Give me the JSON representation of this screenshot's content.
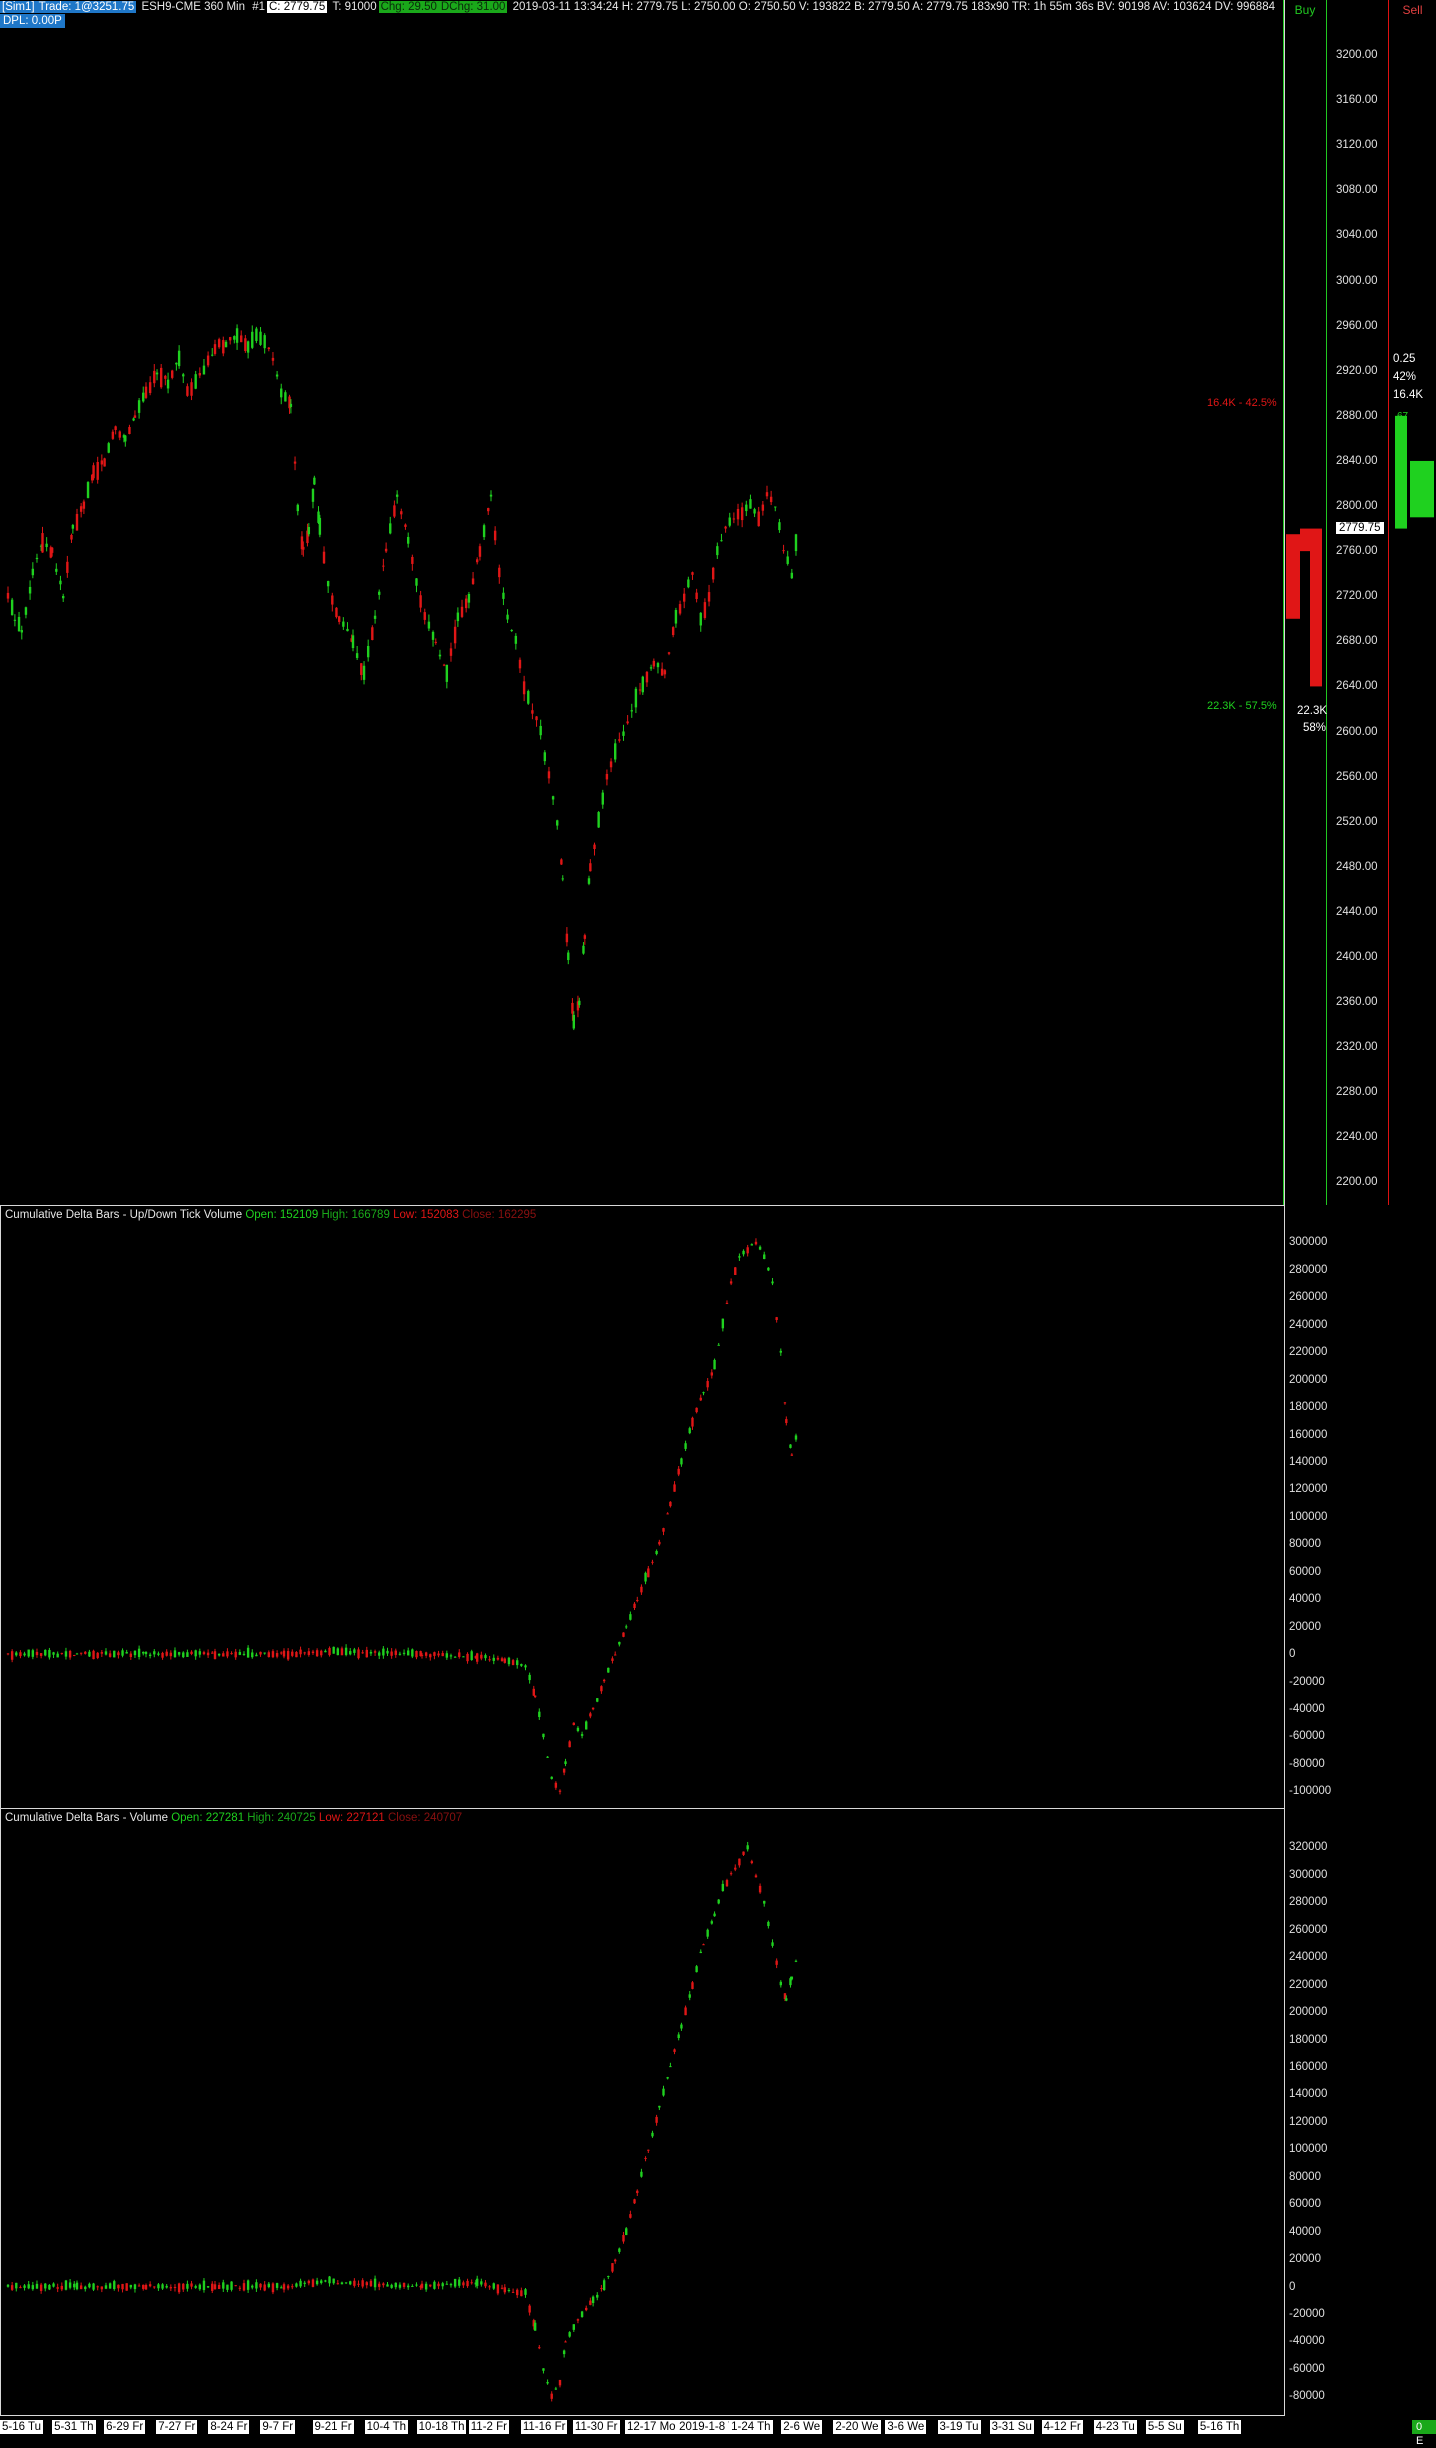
{
  "header": {
    "sim": "[Sim1]",
    "trade": "Trade: 1@3251.75",
    "symbol": "ESH9-CME  360 Min",
    "bar_number": "#1",
    "close": "C: 2779.75",
    "ticks": "T: 91000",
    "chg": "Chg: 29.50",
    "dchg": "DChg: 31.00",
    "info": "2019-03-11 13:34:24 H: 2779.75 L: 2750.00 O: 2750.50 V: 193822 B: 2779.50 A: 2779.75 183x90 TR: 1h 55m 36s BV: 90198 AV: 103624 DV: 996884",
    "dpl": "DPL: 0.00P"
  },
  "dom": {
    "buy_label": "Buy",
    "sell_label": "Sell",
    "price_tag": "2779.75",
    "upper_ratio": "16.4K - 42.5%",
    "lower_ratio": "22.3K - 57.5%",
    "lower_total": "22.3K",
    "lower_pct": "58%",
    "right_tick": "0.25",
    "right_pct": "42%",
    "right_total": "16.4K",
    "right_small": "67"
  },
  "colors": {
    "up": "#1fd11f",
    "down": "#e01616",
    "axis": "#d8d8d8"
  },
  "chart_data": [
    {
      "type": "candlestick",
      "title": "ESH9-CME 360 Min",
      "ylim": [
        2180,
        3240
      ],
      "yticks": [
        "3200.00",
        "3160.00",
        "3120.00",
        "3080.00",
        "3040.00",
        "3000.00",
        "2960.00",
        "2920.00",
        "2880.00",
        "2840.00",
        "2800.00",
        "2760.00",
        "2720.00",
        "2680.00",
        "2640.00",
        "2600.00",
        "2560.00",
        "2520.00",
        "2480.00",
        "2440.00",
        "2400.00",
        "2360.00",
        "2320.00",
        "2280.00",
        "2240.00",
        "2200.00"
      ],
      "x": [
        0,
        5,
        10,
        18,
        25,
        32,
        40,
        47,
        55,
        62,
        70,
        78,
        85,
        92,
        100,
        108,
        116,
        124,
        130,
        136,
        142,
        150,
        158,
        166,
        174,
        180,
        186,
        192,
        198,
        205,
        210,
        214,
        218,
        222,
        226,
        232,
        240,
        250,
        258,
        266,
        274,
        282,
        290,
        296,
        302,
        310,
        318,
        326,
        334,
        342,
        350,
        356,
        362,
        368,
        374,
        380,
        386,
        392,
        398,
        402,
        406,
        410,
        414,
        418,
        422,
        428,
        434,
        440,
        446,
        452,
        460,
        468,
        476,
        484,
        490,
        496,
        502,
        508,
        514,
        520,
        526,
        532,
        538,
        544,
        550,
        556,
        562,
        568,
        572
      ],
      "close": [
        2720,
        2700,
        2690,
        2740,
        2770,
        2760,
        2720,
        2780,
        2800,
        2830,
        2840,
        2870,
        2860,
        2880,
        2900,
        2920,
        2910,
        2930,
        2900,
        2910,
        2920,
        2940,
        2945,
        2950,
        2940,
        2950,
        2945,
        2930,
        2900,
        2890,
        2800,
        2760,
        2780,
        2820,
        2780,
        2730,
        2700,
        2680,
        2650,
        2700,
        2760,
        2810,
        2770,
        2730,
        2700,
        2680,
        2650,
        2700,
        2720,
        2760,
        2810,
        2740,
        2700,
        2680,
        2640,
        2620,
        2600,
        2560,
        2520,
        2470,
        2400,
        2340,
        2360,
        2420,
        2480,
        2520,
        2560,
        2580,
        2600,
        2620,
        2640,
        2660,
        2650,
        2700,
        2720,
        2740,
        2700,
        2720,
        2760,
        2780,
        2790,
        2795,
        2800,
        2790,
        2810,
        2800,
        2760,
        2740,
        2775
      ]
    },
    {
      "type": "candlestick",
      "title": "Cumulative Delta Bars - Up/Down Tick Volume",
      "legend": {
        "open": "Open: 152109",
        "high": "High: 166789",
        "low": "Low: 152083",
        "close": "Close: 162295"
      },
      "ylim": [
        -110000,
        320000
      ],
      "yticks": [
        "300000",
        "280000",
        "260000",
        "240000",
        "220000",
        "200000",
        "180000",
        "160000",
        "140000",
        "120000",
        "100000",
        "80000",
        "60000",
        "40000",
        "20000",
        "0",
        "-20000",
        "-40000",
        "-60000",
        "-80000",
        "-100000"
      ],
      "x": [
        0,
        50,
        100,
        150,
        200,
        230,
        260,
        300,
        340,
        360,
        375,
        382,
        388,
        394,
        400,
        404,
        410,
        416,
        424,
        432,
        440,
        448,
        456,
        464,
        472,
        480,
        488,
        496,
        504,
        512,
        518,
        524,
        530,
        536,
        542,
        548,
        554,
        560,
        564,
        568,
        572
      ],
      "close": [
        0,
        0,
        0,
        0,
        0,
        2000,
        1000,
        0,
        -2000,
        -5000,
        -8000,
        -30000,
        -60000,
        -90000,
        -100000,
        -80000,
        -50000,
        -60000,
        -40000,
        -20000,
        0,
        20000,
        40000,
        60000,
        80000,
        110000,
        140000,
        170000,
        190000,
        210000,
        240000,
        270000,
        290000,
        295000,
        300000,
        290000,
        270000,
        220000,
        170000,
        145000,
        162295
      ]
    },
    {
      "type": "candlestick",
      "title": "Cumulative Delta Bars - Volume",
      "legend": {
        "open": "Open: 227281",
        "high": "High: 240725",
        "low": "Low: 227121",
        "close": "Close: 240707"
      },
      "ylim": [
        -90000,
        340000
      ],
      "yticks": [
        "320000",
        "300000",
        "280000",
        "260000",
        "240000",
        "220000",
        "200000",
        "180000",
        "160000",
        "140000",
        "120000",
        "100000",
        "80000",
        "60000",
        "40000",
        "20000",
        "0",
        "-20000",
        "-40000",
        "-60000",
        "-80000"
      ],
      "x": [
        0,
        50,
        100,
        150,
        200,
        230,
        260,
        300,
        340,
        360,
        375,
        382,
        388,
        394,
        400,
        404,
        410,
        416,
        424,
        432,
        440,
        448,
        456,
        464,
        472,
        480,
        488,
        496,
        504,
        512,
        518,
        524,
        530,
        536,
        542,
        548,
        554,
        560,
        564,
        568,
        572
      ],
      "close": [
        0,
        0,
        0,
        0,
        0,
        4000,
        2000,
        0,
        3000,
        -2000,
        -5000,
        -30000,
        -60000,
        -80000,
        -70000,
        -40000,
        -30000,
        -20000,
        -10000,
        0,
        20000,
        40000,
        70000,
        100000,
        130000,
        160000,
        190000,
        220000,
        250000,
        270000,
        290000,
        300000,
        310000,
        320000,
        300000,
        280000,
        250000,
        220000,
        210000,
        225000,
        240707
      ]
    }
  ],
  "time_axis": [
    "5-16 Tu",
    "5-31 Th",
    "6-29 Fr",
    "7-27 Fr",
    "8-24 Fr",
    "9-7 Fr",
    "9-21 Fr",
    "10-4 Th",
    "10-18 Th",
    "11-2 Fr",
    "11-16 Fr",
    "11-30 Fr",
    "12-17 Mo",
    "2019-1-8 Tu",
    "1-24 Th",
    "2-6 We",
    "2-20 We",
    "3-6 We",
    "3-19 Tu",
    "3-31 Su",
    "4-12 Fr",
    "4-23 Tu",
    "5-5 Su",
    "5-16 Th"
  ],
  "status": "0 E"
}
